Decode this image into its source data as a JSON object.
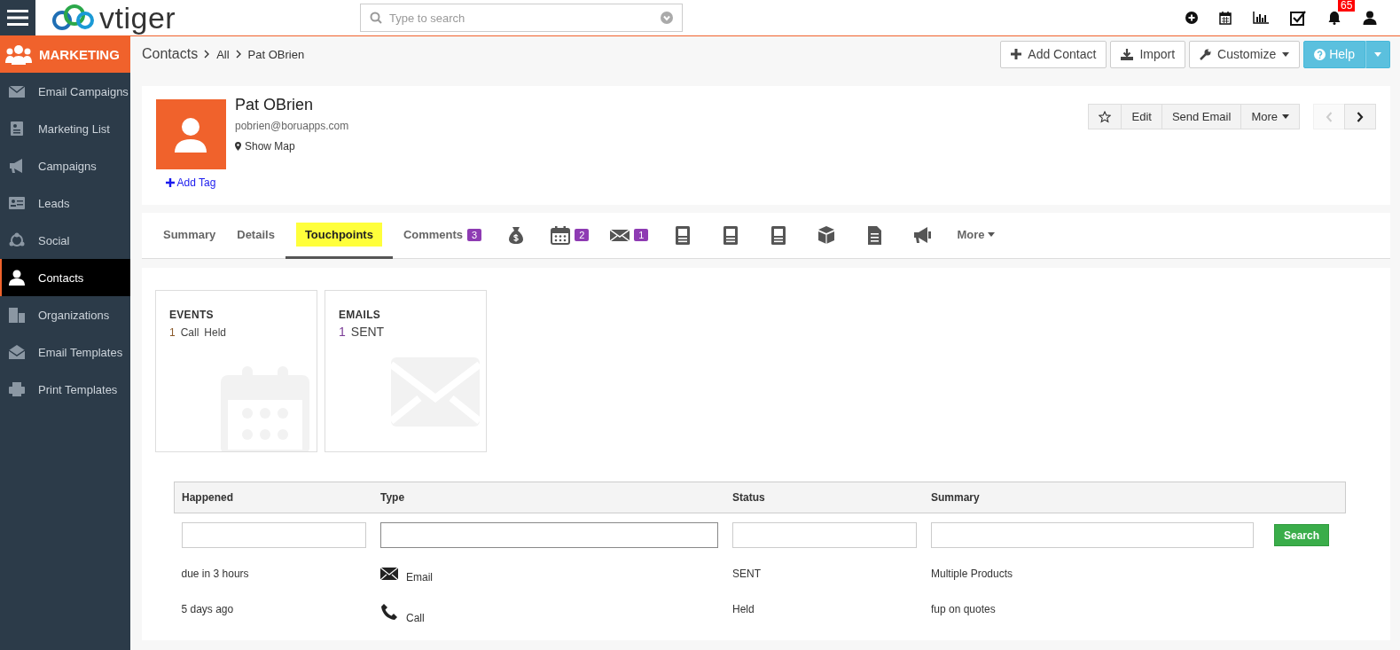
{
  "header": {
    "logo": "vtiger",
    "search": {
      "placeholder": "Type to search"
    },
    "notification_count": "65"
  },
  "sidebar": {
    "module": "MARKETING",
    "items": [
      {
        "label": "Email Campaigns",
        "selected": false
      },
      {
        "label": "Marketing List",
        "selected": false
      },
      {
        "label": "Campaigns",
        "selected": false
      },
      {
        "label": "Leads",
        "selected": false
      },
      {
        "label": "Social",
        "selected": false
      },
      {
        "label": "Contacts",
        "selected": true
      },
      {
        "label": "Organizations",
        "selected": false
      },
      {
        "label": "Email Templates",
        "selected": false
      },
      {
        "label": "Print Templates",
        "selected": false
      }
    ]
  },
  "breadcrumb": [
    "Contacts",
    "All",
    "Pat OBrien"
  ],
  "page_actions": [
    "Add Contact",
    "Import",
    "Customize",
    "Help"
  ],
  "record": {
    "name": "Pat OBrien",
    "email": "pobrien@boruapps.com",
    "map_link": "Show Map",
    "add_tag": "Add Tag",
    "actions": [
      "Edit",
      "Send Email",
      "More"
    ]
  },
  "tabs": [
    {
      "kind": "text",
      "label": "Summary",
      "selected": false
    },
    {
      "kind": "text",
      "label": "Details",
      "selected": false
    },
    {
      "kind": "text",
      "label": "Touchpoints",
      "selected": true
    },
    {
      "kind": "text",
      "label": "Comments",
      "badge": "3",
      "selected": false
    },
    {
      "kind": "icon",
      "selected": false
    },
    {
      "kind": "icon",
      "badge": "2",
      "selected": false
    },
    {
      "kind": "icon",
      "badge": "1",
      "selected": false
    },
    {
      "kind": "icon",
      "selected": false
    },
    {
      "kind": "icon",
      "selected": false
    },
    {
      "kind": "icon",
      "selected": false
    },
    {
      "kind": "icon",
      "selected": false
    },
    {
      "kind": "icon",
      "selected": false
    },
    {
      "kind": "icon",
      "selected": false
    },
    {
      "kind": "menu",
      "label": "More",
      "selected": false
    }
  ],
  "summary_cards": [
    {
      "kind": "events",
      "title": "EVENTS",
      "lines": [
        [
          "1",
          "Call",
          "Held"
        ]
      ]
    },
    {
      "kind": "emails",
      "title": "EMAILS",
      "lines": [
        [
          "1",
          "SENT"
        ]
      ]
    }
  ],
  "table": {
    "columns": [
      "Happened",
      "Type",
      "Status",
      "Summary"
    ],
    "search_button": "Search",
    "rows": [
      {
        "happened": "due in 3 hours",
        "kind": "email",
        "type": "Email",
        "status": "SENT",
        "summary": "Multiple Products"
      },
      {
        "happened": "5 days ago",
        "kind": "call",
        "type": "Call",
        "status": "Held",
        "summary": "fup on quotes"
      }
    ]
  }
}
